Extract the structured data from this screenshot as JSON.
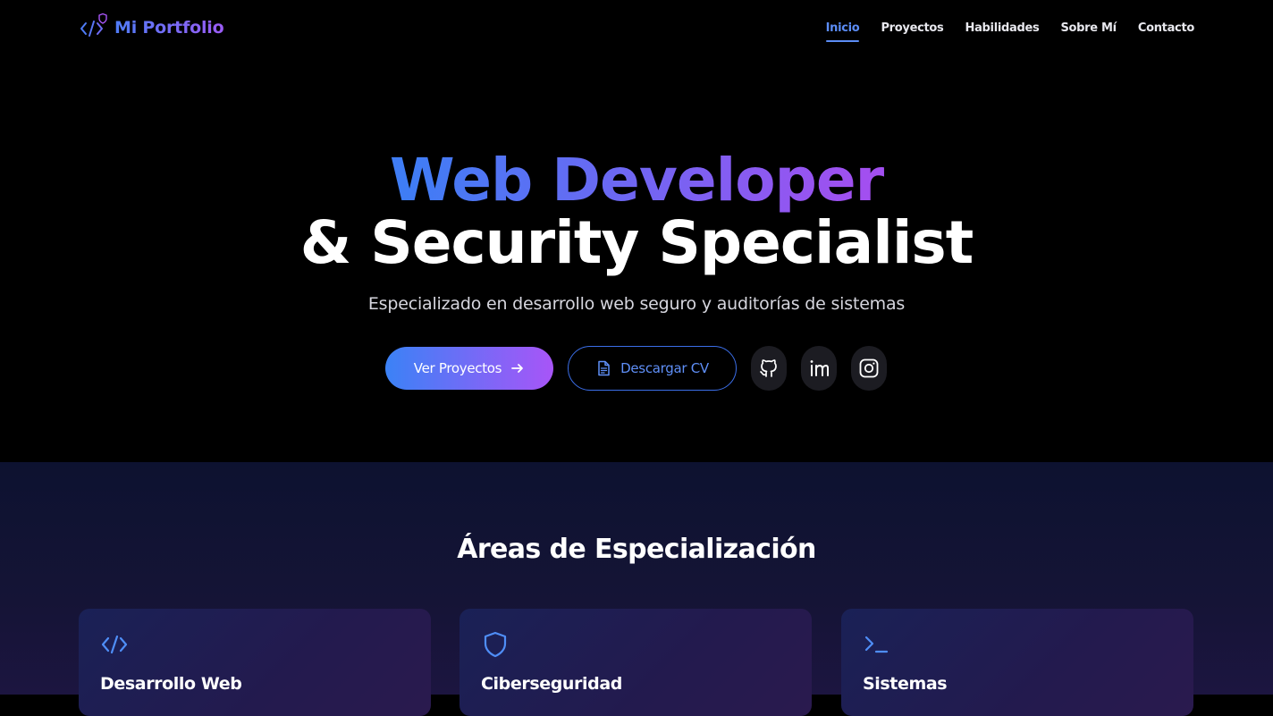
{
  "brand": {
    "name": "Mi Portfolio",
    "icon": "code-shield-icon",
    "color": "#6f6ff5"
  },
  "nav": {
    "items": [
      {
        "label": "Inicio",
        "active": true
      },
      {
        "label": "Proyectos",
        "active": false
      },
      {
        "label": "Habilidades",
        "active": false
      },
      {
        "label": "Sobre Mí",
        "active": false
      },
      {
        "label": "Contacto",
        "active": false
      }
    ],
    "active_color": "#5b8cf5"
  },
  "hero": {
    "title_line1": "Web Developer",
    "title_line2": "& Security Specialist",
    "subtitle": "Especializado en desarrollo web seguro y auditorías de sistemas",
    "primary_button": {
      "label": "Ver Proyectos",
      "icon": "arrow-right-icon"
    },
    "secondary_button": {
      "label": "Descargar CV",
      "icon": "document-icon"
    },
    "social": [
      {
        "name": "github",
        "icon": "github-icon"
      },
      {
        "name": "linkedin",
        "icon": "linkedin-icon"
      },
      {
        "name": "instagram",
        "icon": "instagram-icon"
      }
    ],
    "gradient": [
      "#3b82f6",
      "#a855f7"
    ]
  },
  "areas": {
    "title": "Áreas de Especialización",
    "cards": [
      {
        "title": "Desarrollo Web",
        "icon": "code-icon"
      },
      {
        "title": "Ciberseguridad",
        "icon": "shield-icon"
      },
      {
        "title": "Sistemas",
        "icon": "terminal-icon"
      }
    ]
  }
}
